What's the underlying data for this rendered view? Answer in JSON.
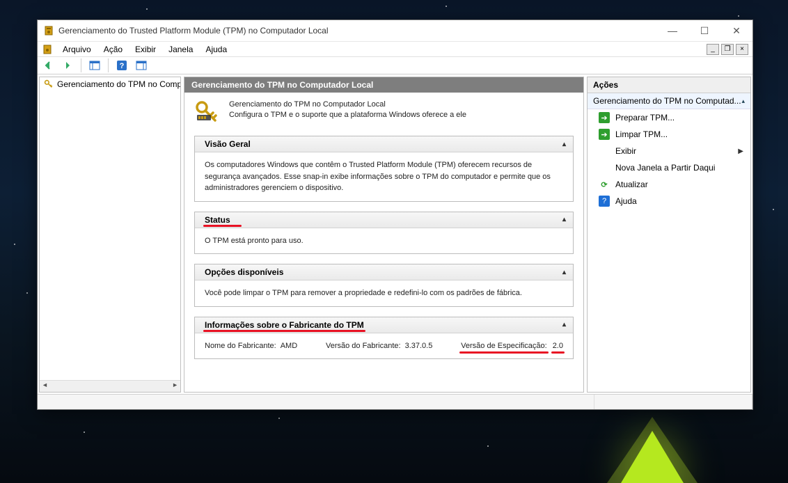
{
  "window": {
    "title": "Gerenciamento do Trusted Platform Module (TPM) no Computador Local"
  },
  "menu": {
    "arquivo": "Arquivo",
    "acao": "Ação",
    "exibir": "Exibir",
    "janela": "Janela",
    "ajuda": "Ajuda"
  },
  "tree": {
    "root": "Gerenciamento do TPM no Computador Local"
  },
  "center": {
    "header": "Gerenciamento do TPM no Computador Local",
    "intro_title": "Gerenciamento do TPM no Computador Local",
    "intro_desc": "Configura o TPM e o suporte que a plataforma Windows oferece a ele"
  },
  "panels": {
    "overview": {
      "title": "Visão Geral",
      "body": "Os computadores Windows que contêm o Trusted Platform Module (TPM) oferecem recursos de segurança avançados. Esse snap-in exibe informações sobre o TPM do computador e permite que os administradores gerenciem o dispositivo."
    },
    "status": {
      "title": "Status",
      "body": "O TPM está pronto para uso."
    },
    "options": {
      "title": "Opções disponíveis",
      "body": "Você pode limpar o TPM para remover a propriedade e redefini-lo com os padrões de fábrica."
    },
    "manufacturer": {
      "title": "Informações sobre o Fabricante do TPM",
      "mfr_name_label": "Nome do Fabricante:",
      "mfr_name": "AMD",
      "mfr_ver_label": "Versão do Fabricante:",
      "mfr_ver": "3.37.0.5",
      "spec_ver_label": "Versão de Especificação:",
      "spec_ver": "2.0"
    }
  },
  "actions": {
    "header": "Ações",
    "subheader": "Gerenciamento do TPM no Computad...",
    "prepare": "Preparar TPM...",
    "clear": "Limpar TPM...",
    "view": "Exibir",
    "newwin": "Nova Janela a Partir Daqui",
    "refresh": "Atualizar",
    "help": "Ajuda"
  }
}
